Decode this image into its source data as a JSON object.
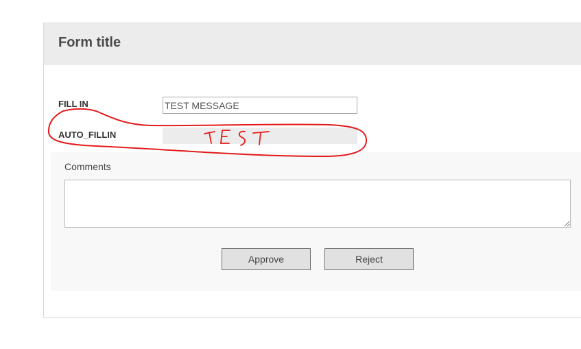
{
  "form": {
    "title": "Form title"
  },
  "fields": {
    "fill_in": {
      "label": "FILL IN",
      "value": "TEST MESSAGE"
    },
    "auto_fillin": {
      "label": "AUTO_FILLIN",
      "value": ""
    }
  },
  "comments": {
    "label": "Comments",
    "value": ""
  },
  "buttons": {
    "approve_label": "Approve",
    "reject_label": "Reject"
  },
  "annotation": {
    "handwritten_text": "TEST",
    "color": "#e31b1b"
  }
}
